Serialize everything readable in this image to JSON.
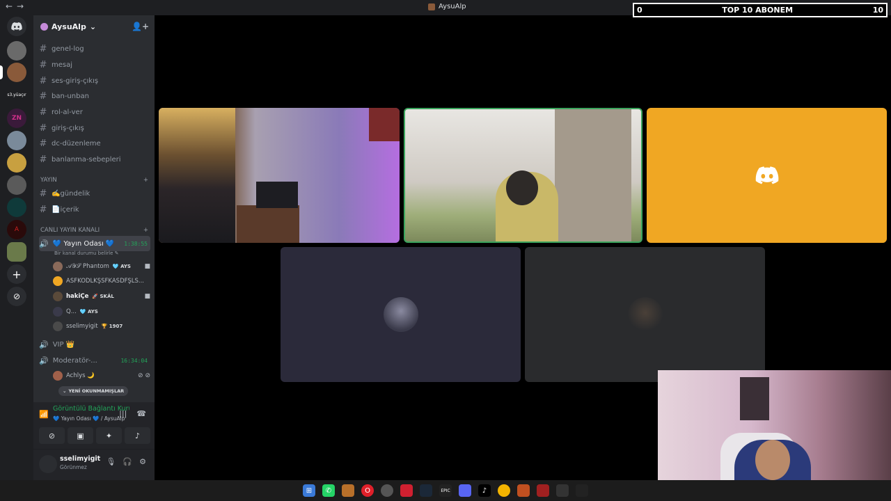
{
  "window": {
    "title": "AysuAlp"
  },
  "overlay": {
    "left": "0",
    "center": "TOP 10 ABONEM",
    "right": "10"
  },
  "server": {
    "name": "AysuAlp",
    "rail_label": "s3.yüaçır"
  },
  "channels": [
    "genel-log",
    "mesaj",
    "ses-giriş-çıkış",
    "ban-unban",
    "rol-al-ver",
    "giriş-çıkış",
    "dc-düzenleme",
    "banlanma-sebepleri"
  ],
  "categories": {
    "yayin": "YAYIN",
    "canli": "CANLI YAYIN KANALI"
  },
  "yayin_channels": [
    "✍️gündelik",
    "📄içerik"
  ],
  "voice": {
    "room1": {
      "name": "💙 Yayın Odası 💙",
      "time": "1:38:55",
      "status": "Bir kanal durumu belirle"
    },
    "users": [
      {
        "name": "𝒜𝒴𝒮 Phantom",
        "tag": "🩵 AYS",
        "cam": true,
        "color": "#8a6a5a"
      },
      {
        "name": "ASFKODLKŞSFKASDFŞLS...",
        "tag": "",
        "cam": false,
        "color": "#f0a723"
      },
      {
        "name": "hakiÇe",
        "tag": "🚀 SKÂL",
        "cam": true,
        "color": "#5a4a3a"
      },
      {
        "name": "Q...",
        "tag": "🩵 AYS",
        "cam": false,
        "color": "#3a3a4a"
      },
      {
        "name": "sselimyigit",
        "tag": "🏆 1907",
        "cam": false,
        "color": "#4a4a4a"
      }
    ],
    "vip": "VIP 👑",
    "moderator": {
      "name": "Moderatör-...",
      "time": "16:34:04"
    },
    "mod_user": "Achlys 🌙",
    "unread": "YENİ OKUNMAMIŞLAR"
  },
  "voice_panel": {
    "title": "Görüntülü Bağlantı Kuruldu",
    "sub": "💙 Yayın Odası 💙 / AysuAlp"
  },
  "user": {
    "name": "sselimyigit",
    "status": "Görünmez"
  },
  "colors": {
    "green": "#23a55a",
    "orange": "#f0a723",
    "blurple": "#5865f2"
  }
}
